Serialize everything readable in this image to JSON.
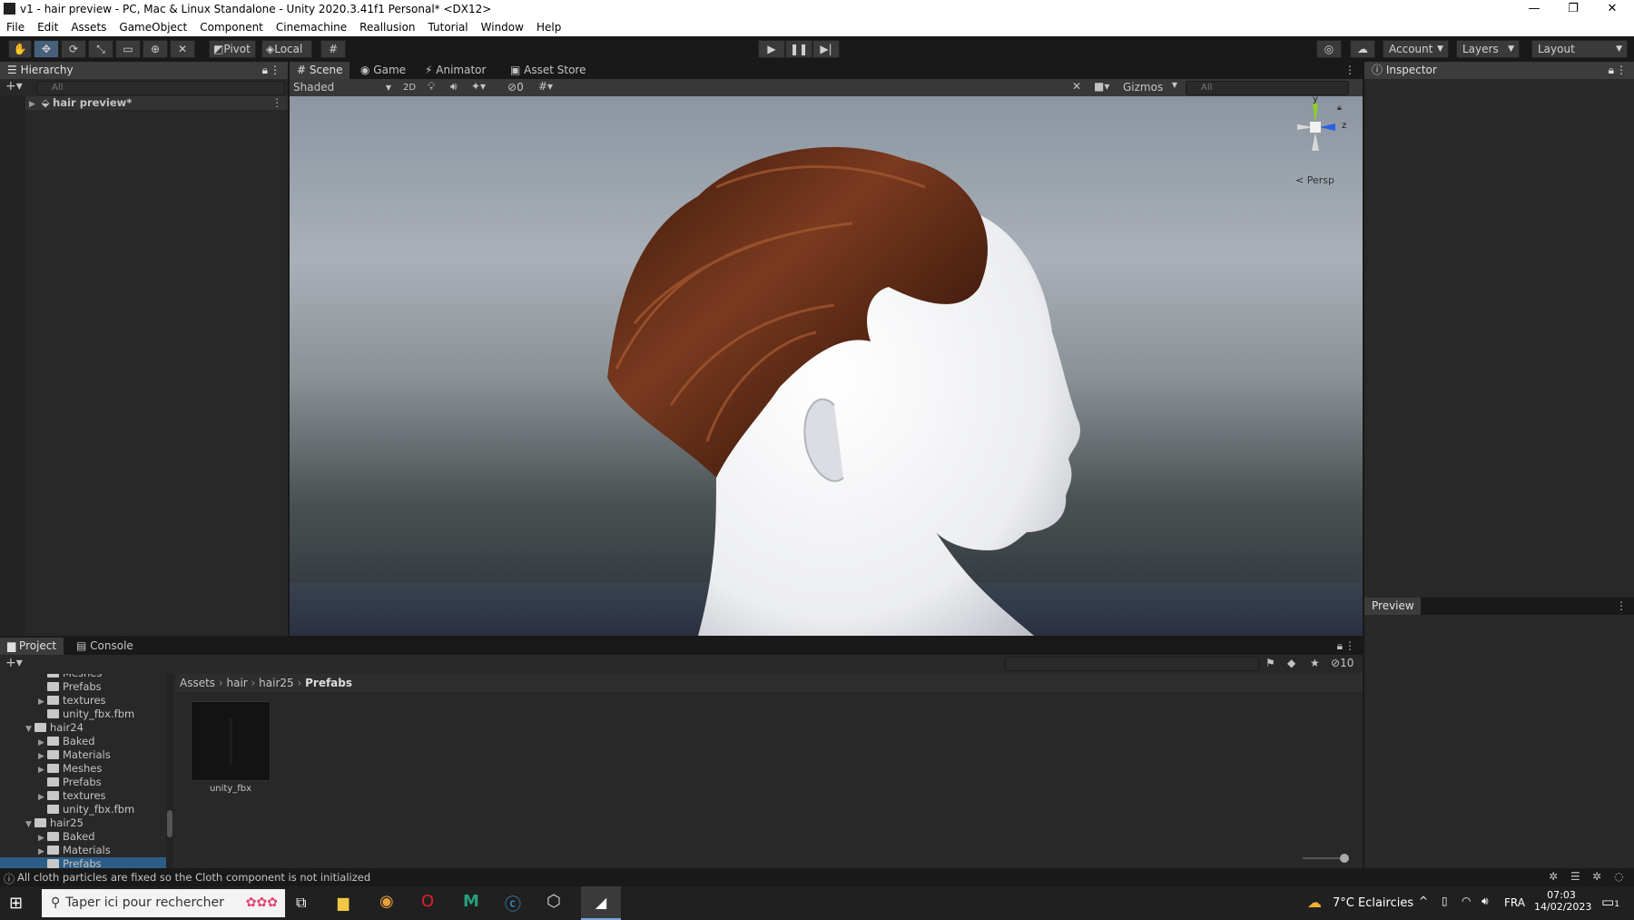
{
  "window": {
    "title": "v1 - hair preview - PC, Mac & Linux Standalone - Unity 2020.3.41f1 Personal* <DX12>",
    "controls": [
      "—",
      "❐",
      "✕"
    ]
  },
  "menu": [
    "File",
    "Edit",
    "Assets",
    "GameObject",
    "Component",
    "Cinemachine",
    "Reallusion",
    "Tutorial",
    "Window",
    "Help"
  ],
  "toolbar": {
    "pivot_label": "Pivot",
    "local_label": "Local",
    "account_label": "Account",
    "layers_label": "Layers",
    "layout_label": "Layout"
  },
  "hierarchy": {
    "tab_label": "Hierarchy",
    "search_placeholder": "All",
    "scene_name": "hair preview*"
  },
  "scene_tabs": [
    "Scene",
    "Game",
    "Animator",
    "Asset Store"
  ],
  "scene_toolbar": {
    "shading_mode": "Shaded",
    "mode_2d": "2D",
    "hidden_count": "0",
    "gizmos_label": "Gizmos",
    "search_placeholder": "All"
  },
  "gizmo": {
    "y_label": "y",
    "z_label": "z",
    "projection_label": "< Persp"
  },
  "inspector": {
    "tab_label": "Inspector",
    "preview_label": "Preview"
  },
  "project": {
    "tabs": [
      "Project",
      "Console"
    ],
    "tree": [
      {
        "label": "Meshes",
        "indent": 2,
        "arrow": false,
        "partial": true
      },
      {
        "label": "Prefabs",
        "indent": 2,
        "arrow": false
      },
      {
        "label": "textures",
        "indent": 2,
        "arrow": true
      },
      {
        "label": "unity_fbx.fbm",
        "indent": 2,
        "arrow": false
      },
      {
        "label": "hair24",
        "indent": 1,
        "arrow": "open"
      },
      {
        "label": "Baked",
        "indent": 2,
        "arrow": true
      },
      {
        "label": "Materials",
        "indent": 2,
        "arrow": true
      },
      {
        "label": "Meshes",
        "indent": 2,
        "arrow": true
      },
      {
        "label": "Prefabs",
        "indent": 2,
        "arrow": false
      },
      {
        "label": "textures",
        "indent": 2,
        "arrow": true
      },
      {
        "label": "unity_fbx.fbm",
        "indent": 2,
        "arrow": false
      },
      {
        "label": "hair25",
        "indent": 1,
        "arrow": "open"
      },
      {
        "label": "Baked",
        "indent": 2,
        "arrow": true
      },
      {
        "label": "Materials",
        "indent": 2,
        "arrow": true
      },
      {
        "label": "Prefabs",
        "indent": 2,
        "arrow": false,
        "selected": true
      }
    ],
    "breadcrumb": [
      "Assets",
      "hair",
      "hair25",
      "Prefabs"
    ],
    "asset_name": "unity_fbx",
    "hidden_count": "10"
  },
  "status": {
    "message": "All cloth particles are fixed so the Cloth component is not initialized"
  },
  "taskbar": {
    "search_placeholder": "Taper ici pour rechercher",
    "weather": "7°C  Eclaircies",
    "language": "FRA",
    "time": "07:03",
    "date": "14/02/2023",
    "notification_count": "1"
  },
  "colors": {
    "panel_bg": "#282828",
    "toolbar_bg": "#191919",
    "accent": "#46607c",
    "hair": "#5a2818",
    "skin": "#f2f2f4"
  }
}
